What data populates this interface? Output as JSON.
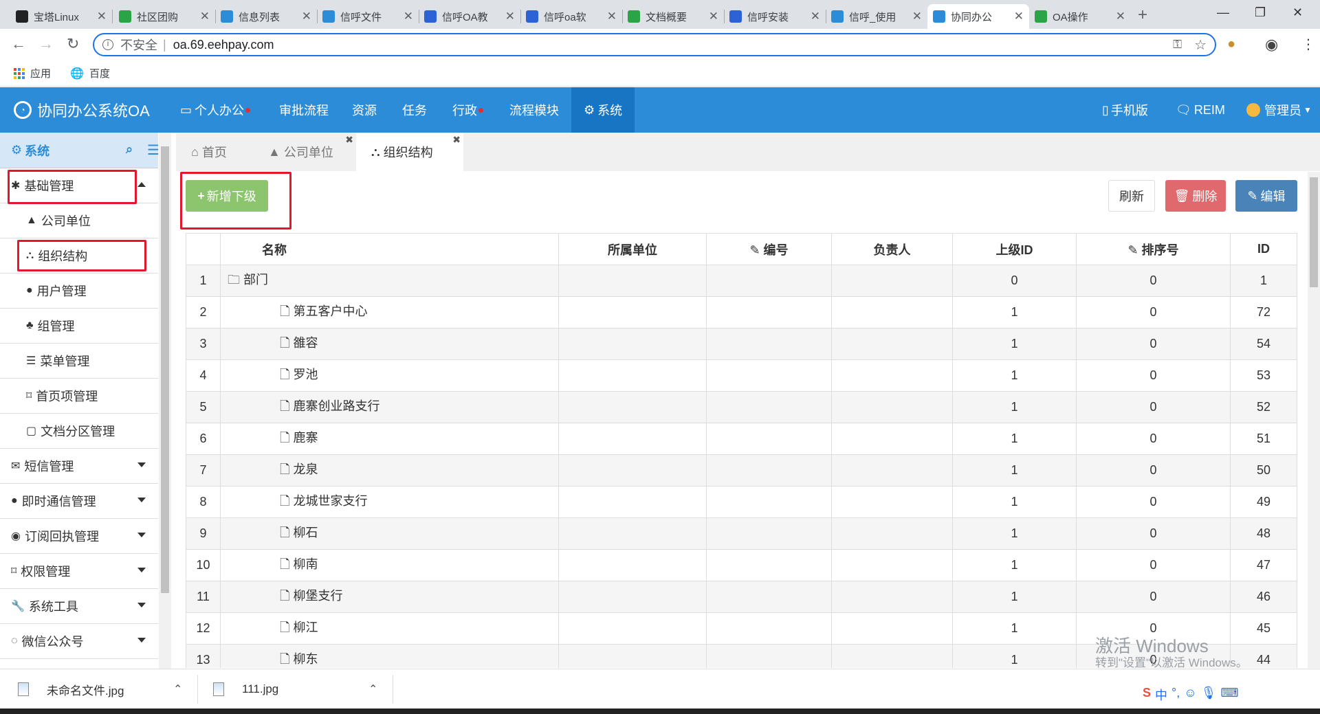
{
  "browser": {
    "tabs": [
      {
        "title": "宝塔Linux",
        "icon": "bt-icon",
        "color": "#222222"
      },
      {
        "title": "社区团购",
        "icon": "community-icon",
        "color": "#2aa447"
      },
      {
        "title": "信息列表",
        "icon": "chat-icon",
        "color": "#2d8cd7"
      },
      {
        "title": "信呼文件",
        "icon": "chat-icon",
        "color": "#2d8cd7"
      },
      {
        "title": "信呼OA教",
        "icon": "baidu-icon",
        "color": "#2d62d7"
      },
      {
        "title": "信呼oa软",
        "icon": "globe-icon",
        "color": "#2d62d7"
      },
      {
        "title": "文档概要",
        "icon": "community-icon",
        "color": "#2aa447"
      },
      {
        "title": "信呼安装",
        "icon": "baidu-icon",
        "color": "#2d62d7"
      },
      {
        "title": "信呼_使用",
        "icon": "chat-icon",
        "color": "#2d8cd7"
      },
      {
        "title": "协同办公",
        "icon": "chat-icon",
        "color": "#2d8cd7"
      },
      {
        "title": "OA操作",
        "icon": "community-icon",
        "color": "#2aa447"
      }
    ],
    "active_tab_index": 9,
    "address": {
      "security_label": "不安全",
      "url": "oa.69.eehpay.com"
    },
    "bookmarks": {
      "apps": "应用",
      "baidu": "百度"
    }
  },
  "app": {
    "brand": "协同办公系统OA",
    "nav": [
      {
        "label": "个人办公",
        "dot": true
      },
      {
        "label": "审批流程",
        "dot": false
      },
      {
        "label": "资源",
        "dot": false
      },
      {
        "label": "任务",
        "dot": false
      },
      {
        "label": "行政",
        "dot": true
      },
      {
        "label": "流程模块",
        "dot": false
      },
      {
        "label": "系统",
        "dot": false
      }
    ],
    "active_nav": "系统",
    "right_nav": {
      "mobile": "手机版",
      "reim": "REIM",
      "admin": "管理员"
    },
    "colors": {
      "header": "#2d8cd7",
      "active_nav": "#1775c3",
      "add_button": "#8cc56e",
      "delete_button": "#e0696e",
      "edit_button": "#4a83b8",
      "annotation": "#e2162c"
    }
  },
  "sidebar": {
    "title": "系统",
    "items": [
      {
        "label": "基础管理",
        "level": "top",
        "icon": "asterisk-icon",
        "expanded": true
      },
      {
        "label": "公司单位",
        "level": "sub",
        "icon": "building-icon"
      },
      {
        "label": "组织结构",
        "level": "sub",
        "icon": "sitemap-icon"
      },
      {
        "label": "用户管理",
        "level": "sub",
        "icon": "user-icon"
      },
      {
        "label": "组管理",
        "level": "sub",
        "icon": "users-icon"
      },
      {
        "label": "菜单管理",
        "level": "sub",
        "icon": "list-icon"
      },
      {
        "label": "首页项管理",
        "level": "sub",
        "icon": "bookmark-icon"
      },
      {
        "label": "文档分区管理",
        "level": "sub",
        "icon": "folder-icon"
      },
      {
        "label": "短信管理",
        "level": "top",
        "icon": "envelope-icon"
      },
      {
        "label": "即时通信管理",
        "level": "top",
        "icon": "comment-icon"
      },
      {
        "label": "订阅回执管理",
        "level": "top",
        "icon": "rss-icon"
      },
      {
        "label": "权限管理",
        "level": "top",
        "icon": "bookmark-icon"
      },
      {
        "label": "系统工具",
        "level": "top",
        "icon": "wrench-icon"
      },
      {
        "label": "微信公众号",
        "level": "top",
        "icon": "comments-icon"
      }
    ]
  },
  "content_tabs": [
    {
      "label": "首页",
      "icon": "home-icon",
      "closable": false
    },
    {
      "label": "公司单位",
      "icon": "building-icon",
      "closable": true
    },
    {
      "label": "组织结构",
      "icon": "sitemap-icon",
      "closable": true
    }
  ],
  "toolbar": {
    "add": "新增下级",
    "refresh": "刷新",
    "delete": "删除",
    "edit": "编辑"
  },
  "table": {
    "columns": [
      "名称",
      "所属单位",
      "编号",
      "负责人",
      "上级ID",
      "排序号",
      "ID"
    ],
    "rows": [
      {
        "n": "1",
        "name": "部门",
        "unit": "",
        "code": "",
        "owner": "",
        "pid": "0",
        "sort": "0",
        "id": "1",
        "root": true
      },
      {
        "n": "2",
        "name": "第五客户中心",
        "unit": "",
        "code": "",
        "owner": "",
        "pid": "1",
        "sort": "0",
        "id": "72"
      },
      {
        "n": "3",
        "name": "雒容",
        "unit": "",
        "code": "",
        "owner": "",
        "pid": "1",
        "sort": "0",
        "id": "54"
      },
      {
        "n": "4",
        "name": "罗池",
        "unit": "",
        "code": "",
        "owner": "",
        "pid": "1",
        "sort": "0",
        "id": "53"
      },
      {
        "n": "5",
        "name": "鹿寨创业路支行",
        "unit": "",
        "code": "",
        "owner": "",
        "pid": "1",
        "sort": "0",
        "id": "52"
      },
      {
        "n": "6",
        "name": "鹿寨",
        "unit": "",
        "code": "",
        "owner": "",
        "pid": "1",
        "sort": "0",
        "id": "51"
      },
      {
        "n": "7",
        "name": "龙泉",
        "unit": "",
        "code": "",
        "owner": "",
        "pid": "1",
        "sort": "0",
        "id": "50"
      },
      {
        "n": "8",
        "name": "龙城世家支行",
        "unit": "",
        "code": "",
        "owner": "",
        "pid": "1",
        "sort": "0",
        "id": "49"
      },
      {
        "n": "9",
        "name": "柳石",
        "unit": "",
        "code": "",
        "owner": "",
        "pid": "1",
        "sort": "0",
        "id": "48"
      },
      {
        "n": "10",
        "name": "柳南",
        "unit": "",
        "code": "",
        "owner": "",
        "pid": "1",
        "sort": "0",
        "id": "47"
      },
      {
        "n": "11",
        "name": "柳堡支行",
        "unit": "",
        "code": "",
        "owner": "",
        "pid": "1",
        "sort": "0",
        "id": "46"
      },
      {
        "n": "12",
        "name": "柳江",
        "unit": "",
        "code": "",
        "owner": "",
        "pid": "1",
        "sort": "0",
        "id": "45"
      },
      {
        "n": "13",
        "name": "柳东",
        "unit": "",
        "code": "",
        "owner": "",
        "pid": "1",
        "sort": "0",
        "id": "44"
      }
    ]
  },
  "downloads": [
    {
      "name": "未命名文件.jpg"
    },
    {
      "name": "111.jpg"
    }
  ],
  "watermark": {
    "line1": "激活 Windows",
    "line2": "转到\"设置\"以激活 Windows。"
  }
}
